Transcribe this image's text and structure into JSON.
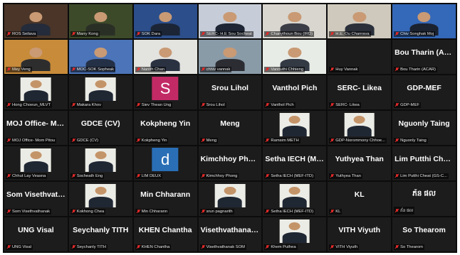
{
  "colors": {
    "grid_bg": "#0c0c0c",
    "tile_bg": "#1c1c1c",
    "mic_muted": "#e02a2a"
  },
  "participants": [
    {
      "label": "ROS Seilava",
      "kind": "video",
      "bg": "#4a3528",
      "shirt": "#242b3a"
    },
    {
      "label": "Marry Kong",
      "kind": "video",
      "bg": "#3d4a2a",
      "shirt": "#2a2f26"
    },
    {
      "label": "SOK Dara",
      "kind": "video",
      "bg": "#2c4e8a",
      "shirt": "#1b2536"
    },
    {
      "label": "SERC- H.E Sou Socheat",
      "kind": "video",
      "bg": "#c7cdd8",
      "shirt": "#1e2635"
    },
    {
      "label": "Chanythoun Bou (IRD)",
      "kind": "video",
      "bg": "#d9d6cf",
      "shirt": "#3a3c46"
    },
    {
      "label": "H.E. Ou Chanrava",
      "kind": "video",
      "bg": "#cfc9bd",
      "shirt": "#2a2f3a"
    },
    {
      "label": "Chiv Songhak Moj",
      "kind": "video",
      "bg": "#3468b8",
      "shirt": "#1b2230"
    },
    {
      "label": "Mey Veng",
      "kind": "video",
      "bg": "#c88b3a",
      "shirt": "#2d2d2d"
    },
    {
      "label": "MOC-SOK Sopheak",
      "kind": "video",
      "bg": "#4c74b8",
      "shirt": "#243046"
    },
    {
      "label": "Nanith Chan",
      "kind": "video",
      "bg": "#e3e3df",
      "shirt": "#2a3242"
    },
    {
      "label": "chhiv vannak",
      "kind": "video",
      "bg": "#8a9ba8",
      "shirt": "#2b2d33"
    },
    {
      "label": "Vannuthi Chhieng",
      "kind": "video",
      "bg": "#e8ece6",
      "shirt": "#333a44"
    },
    {
      "label": "Huy Vannak",
      "kind": "blank",
      "name": ""
    },
    {
      "label": "Bou Tharin (ACAR)",
      "kind": "name",
      "name": "Bou Tharin (AC..."
    },
    {
      "label": "Hong Choeun_MLVT",
      "kind": "photo"
    },
    {
      "label": "Makara Khov",
      "kind": "photo"
    },
    {
      "label": "Siev Thean Ung",
      "kind": "avatar",
      "letter": "S",
      "color": "#c22a66"
    },
    {
      "label": "Srou Lihol",
      "kind": "name",
      "name": "Srou Lihol"
    },
    {
      "label": "Vanthol Pich",
      "kind": "name",
      "name": "Vanthol Pich"
    },
    {
      "label": "SERC- Likea",
      "kind": "name",
      "name": "SERC- Likea"
    },
    {
      "label": "GDP-MEF",
      "kind": "name",
      "name": "GDP-MEF"
    },
    {
      "label": "MOJ Office- Mom Pitou",
      "kind": "name",
      "name": "MOJ Office- Mo..."
    },
    {
      "label": "GDCE (CV)",
      "kind": "name",
      "name": "GDCE (CV)"
    },
    {
      "label": "Kokpheng Yin",
      "kind": "name",
      "name": "Kokpheng Yin"
    },
    {
      "label": "Meng",
      "kind": "name",
      "name": "Meng"
    },
    {
      "label": "Ramsim METH",
      "kind": "photo"
    },
    {
      "label": "GDP-Norommony Chhoe...",
      "kind": "photo"
    },
    {
      "label": "Nguonly Taing",
      "kind": "name",
      "name": "Nguonly Taing"
    },
    {
      "label": "Chhut Lay Veasna",
      "kind": "photo"
    },
    {
      "label": "Socheath Eng",
      "kind": "photo"
    },
    {
      "label": "LIM DEUX",
      "kind": "avatar",
      "letter": "d",
      "color": "#2a6fb6"
    },
    {
      "label": "Kimchhoy Phong",
      "kind": "name",
      "name": "Kimchhoy Phong"
    },
    {
      "label": "Setha IECH (MEF-ITD)",
      "kind": "name",
      "name": "Setha IECH (ME..."
    },
    {
      "label": "Yuthyea Than",
      "kind": "name",
      "name": "Yuthyea Than"
    },
    {
      "label": "Lim Putthi Cheat (GS-C...",
      "kind": "name",
      "name": "Lim Putthi Chea..."
    },
    {
      "label": "Som Visethvathanak",
      "kind": "name",
      "name": "Som Visethvath..."
    },
    {
      "label": "Kokhong Chea",
      "kind": "photo"
    },
    {
      "label": "Min Chharann",
      "kind": "name",
      "name": "Min Chharann"
    },
    {
      "label": "srun pagnarith",
      "kind": "photo"
    },
    {
      "label": "Setha IECH (MEF-ITD)",
      "kind": "photo"
    },
    {
      "label": "KL",
      "kind": "name",
      "name": "KL"
    },
    {
      "label": "ភ័ន ផល",
      "kind": "name",
      "name": "ភ័ន ផល"
    },
    {
      "label": "UNG Visal",
      "kind": "name",
      "name": "UNG Visal"
    },
    {
      "label": "Seychanly TITH",
      "kind": "name",
      "name": "Seychanly TITH"
    },
    {
      "label": "KHEN Chantha",
      "kind": "name",
      "name": "KHEN Chantha"
    },
    {
      "label": "Visethvathanak SOM",
      "kind": "name",
      "name": "Visethvathanak..."
    },
    {
      "label": "Khem Puthea",
      "kind": "photo"
    },
    {
      "label": "VITH Viyuth",
      "kind": "name",
      "name": "VITH Viyuth"
    },
    {
      "label": "So Thearom",
      "kind": "name",
      "name": "So Thearom"
    }
  ]
}
